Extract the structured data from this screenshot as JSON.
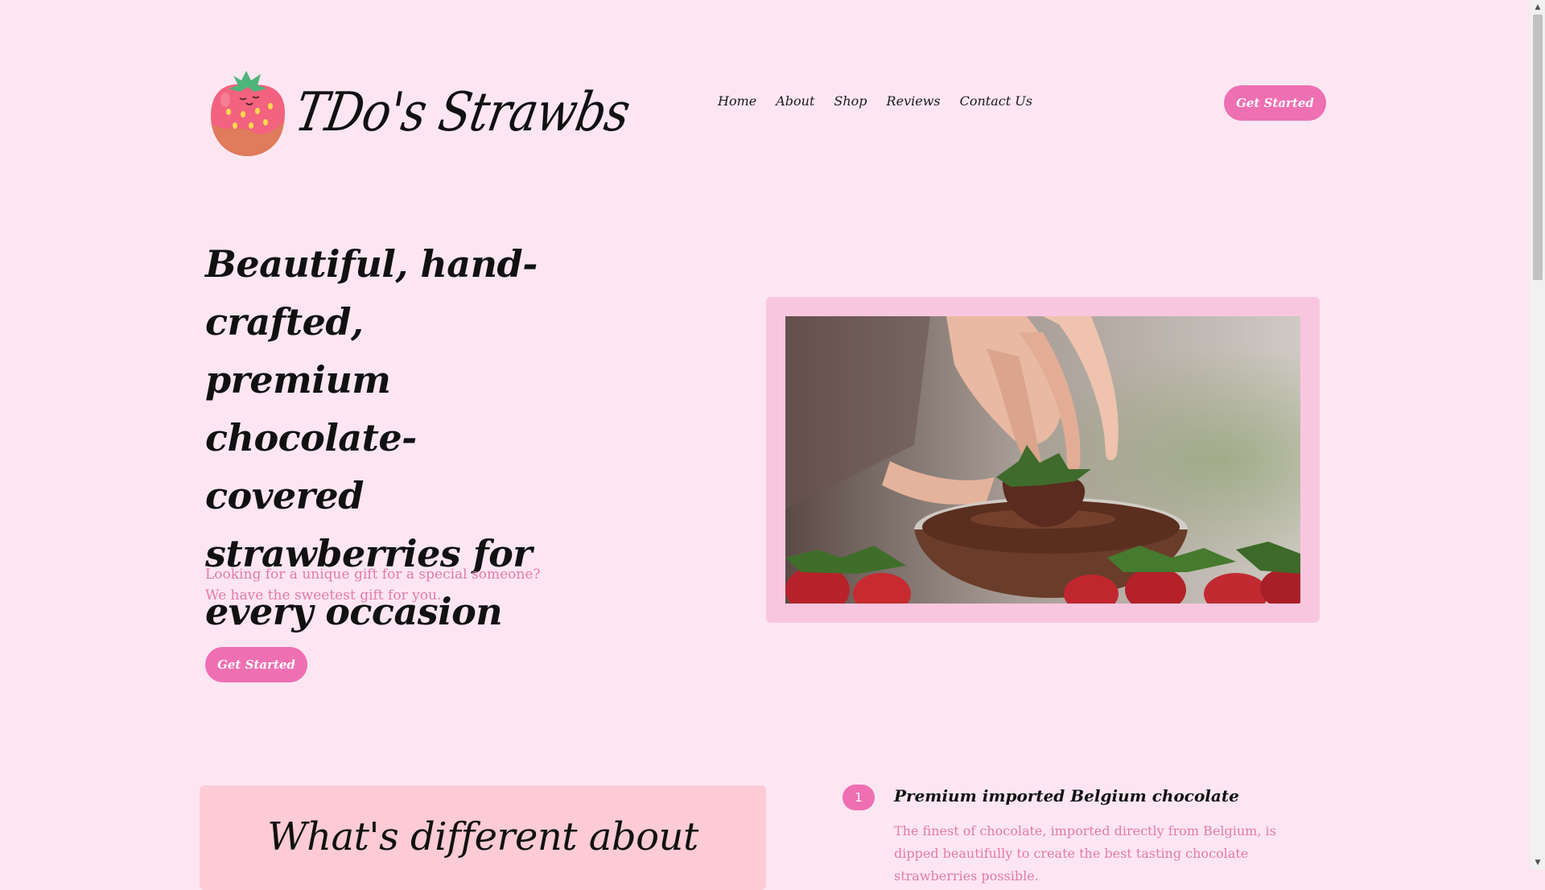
{
  "brand": {
    "name": "TDo's Strawbs",
    "logo_icon": "strawberry-icon"
  },
  "nav": {
    "items": [
      {
        "label": "Home"
      },
      {
        "label": "About"
      },
      {
        "label": "Shop"
      },
      {
        "label": "Reviews"
      },
      {
        "label": "Contact Us"
      }
    ],
    "cta_label": "Get Started"
  },
  "hero": {
    "title": "Beautiful, hand-crafted, premium chocolate-covered strawberries for every occasion",
    "subtitle": "Looking for a unique gift for a special someone? We have the sweetest gift for you.",
    "cta_label": "Get Started"
  },
  "section2": {
    "title": "What's different about",
    "features": [
      {
        "number": "1",
        "title": "Premium imported Belgium chocolate",
        "description": "The finest of chocolate, imported directly from Belgium, is dipped beautifully to create the best tasting chocolate strawberries possible."
      }
    ]
  },
  "colors": {
    "background": "#fde6f1",
    "accent": "#ef6fb3",
    "frame": "#f9c6df",
    "card": "#fccbd6",
    "muted_text": "#e47aaa"
  }
}
